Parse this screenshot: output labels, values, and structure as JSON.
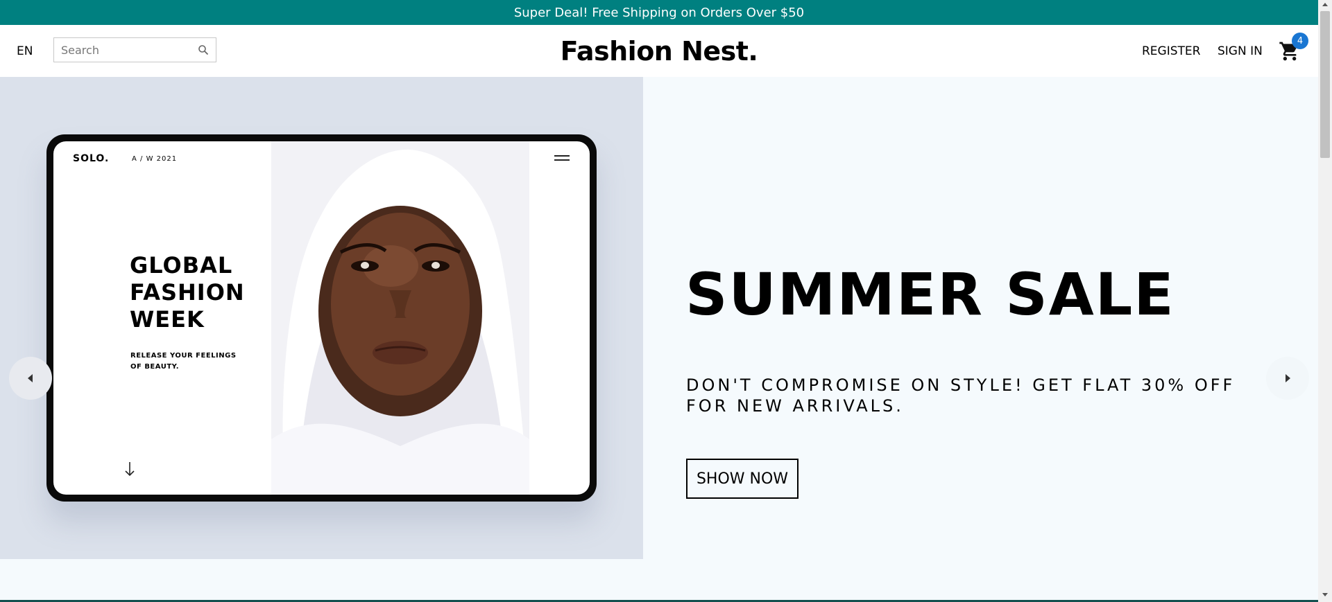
{
  "announcement": {
    "text": "Super Deal! Free Shipping on Orders Over $50",
    "bg_color": "#008080"
  },
  "navbar": {
    "language": "EN",
    "search": {
      "placeholder": "Search",
      "value": "",
      "icon": "search-icon"
    },
    "logo": "Fashion Nest.",
    "register_label": "REGISTER",
    "signin_label": "SIGN IN",
    "cart": {
      "icon": "cart-icon",
      "count": "4",
      "badge_color": "#1976d2"
    }
  },
  "hero": {
    "image": {
      "brand": "SOLO.",
      "season": "A / W 2021",
      "headline": "GLOBAL\nFASHION\nWEEK",
      "tagline": "RELEASE YOUR FEELINGS\nOF BEAUTY."
    },
    "title": "SUMMER SALE",
    "subtitle": "DON'T COMPROMISE ON STYLE! GET FLAT 30% OFF FOR NEW ARRIVALS.",
    "button_label": "SHOW NOW",
    "left_bg": "#dbe1eb",
    "right_bg": "#f5fafd",
    "prev_icon": "arrow-left-icon",
    "next_icon": "arrow-right-icon"
  }
}
